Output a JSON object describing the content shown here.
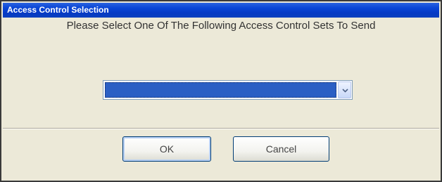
{
  "window": {
    "title": "Access Control Selection"
  },
  "dialog": {
    "prompt": "Please Select One Of The Following Access Control Sets To Send",
    "combo": {
      "selected_value": "",
      "arrow_icon": "chevron-down-icon"
    },
    "buttons": {
      "ok_label": "OK",
      "cancel_label": "Cancel"
    }
  },
  "colors": {
    "titlebar": "#0a46d6",
    "dialog_background": "#ece9d8",
    "selection_highlight": "#2b5fc4"
  }
}
